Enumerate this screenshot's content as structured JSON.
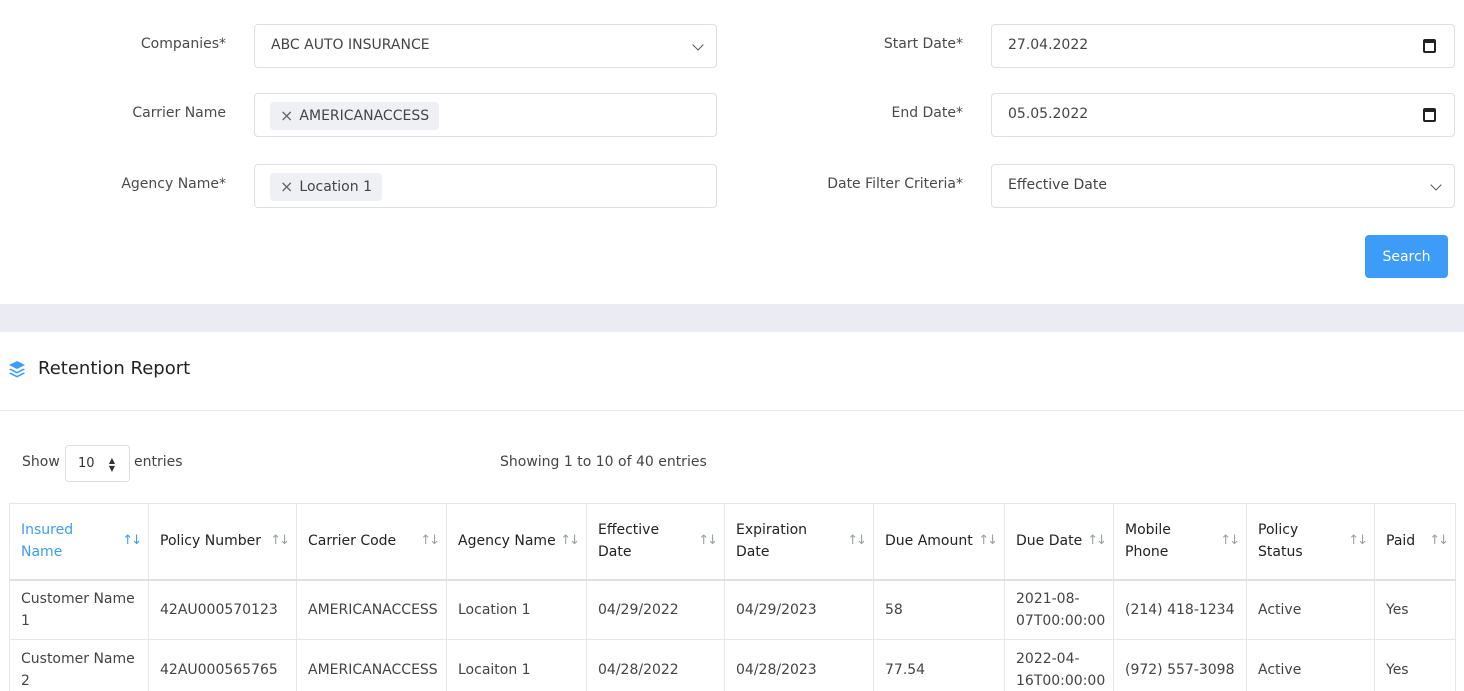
{
  "form": {
    "companies": {
      "label": "Companies*",
      "value": "ABC AUTO INSURANCE"
    },
    "carrier": {
      "label": "Carrier Name",
      "tag": "AMERICANACCESS"
    },
    "agency": {
      "label": "Agency Name*",
      "tag": "Location 1"
    },
    "start_date": {
      "label": "Start Date*",
      "value": "27.04.2022"
    },
    "end_date": {
      "label": "End Date*",
      "value": "05.05.2022"
    },
    "criteria": {
      "label": "Date Filter Criteria*",
      "value": "Effective Date"
    },
    "search_label": "Search"
  },
  "report": {
    "title": "Retention Report",
    "show_label": "Show",
    "page_size": "10",
    "entries_label": "entries",
    "showing_text": "Showing 1 to 10 of 40 entries"
  },
  "table": {
    "headers": [
      "Insured Name",
      "Policy Number",
      "Carrier Code",
      "Agency Name",
      "Effective Date",
      "Expiration Date",
      "Due Amount",
      "Due Date",
      "Mobile Phone",
      "Policy Status",
      "Paid"
    ],
    "rows": [
      [
        "Customer Name 1",
        "42AU000570123",
        "AMERICANACCESS",
        "Location 1",
        "04/29/2022",
        "04/29/2023",
        "58",
        "2021-08-07T00:00:00",
        "(214) 418-1234",
        "Active",
        "Yes"
      ],
      [
        "Customer Name 2",
        "42AU000565765",
        "AMERICANACCESS",
        "Locaiton 1",
        "04/28/2022",
        "04/28/2023",
        "77.54",
        "2022-04-16T00:00:00",
        "(972) 557-3098",
        "Active",
        "Yes"
      ]
    ]
  },
  "colors": {
    "accent": "#3d9cf7",
    "band": "#eaebf3"
  },
  "icons": {
    "report": "layers-icon",
    "sort": "sort-arrows-icon",
    "calendar": "calendar-icon",
    "dropdown": "chevron-down-icon",
    "remove": "close-icon"
  }
}
